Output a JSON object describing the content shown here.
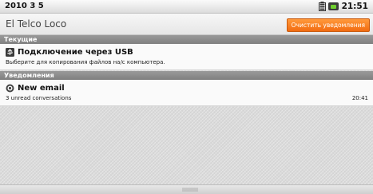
{
  "status_bar": {
    "date": "2010 3 5",
    "time": "21:51",
    "icons": [
      "battery-icon",
      "usb-connected-icon"
    ]
  },
  "header": {
    "carrier": "El Telco Loco",
    "clear_button": "Очистить уведомления"
  },
  "sections": {
    "ongoing": {
      "title": "Текущие",
      "items": [
        {
          "icon": "usb-icon",
          "title": "Подключение через USB",
          "subtitle": "Выберите для копирования файлов на/с компьютера."
        }
      ]
    },
    "notifications": {
      "title": "Уведомления",
      "items": [
        {
          "icon": "email-icon",
          "title": "New email",
          "subtitle": "3 unread conversations",
          "time": "20:41"
        }
      ]
    }
  },
  "colors": {
    "accent": "#f26b10",
    "section_header": "#8a8a8a",
    "background": "#d9d9d9"
  }
}
